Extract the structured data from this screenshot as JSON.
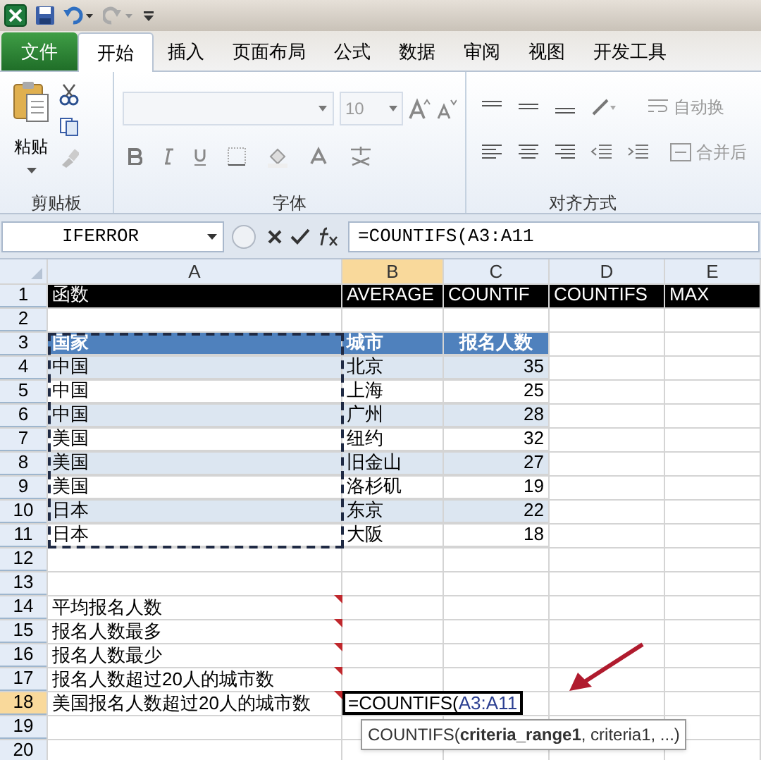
{
  "tabs": [
    {
      "label": "文件",
      "kind": "file",
      "selected": false
    },
    {
      "label": "开始",
      "kind": "tab",
      "selected": true
    },
    {
      "label": "插入",
      "kind": "tab",
      "selected": false
    },
    {
      "label": "页面布局",
      "kind": "tab",
      "selected": false
    },
    {
      "label": "公式",
      "kind": "tab",
      "selected": false
    },
    {
      "label": "数据",
      "kind": "tab",
      "selected": false
    },
    {
      "label": "审阅",
      "kind": "tab",
      "selected": false
    },
    {
      "label": "视图",
      "kind": "tab",
      "selected": false
    },
    {
      "label": "开发工具",
      "kind": "tab",
      "selected": false
    }
  ],
  "ribbon": {
    "clipboard": {
      "paste": "粘贴",
      "title": "剪贴板"
    },
    "font": {
      "size": "10",
      "title": "字体"
    },
    "alignment": {
      "wrap": "自动换",
      "merge": "合并后",
      "title": "对齐方式"
    }
  },
  "formula_bar": {
    "name_box": "IFERROR",
    "formula": "=COUNTIFS(A3:A11"
  },
  "columns": [
    {
      "letter": "A",
      "selected": false
    },
    {
      "letter": "B",
      "selected": true
    },
    {
      "letter": "C",
      "selected": false
    },
    {
      "letter": "D",
      "selected": false
    },
    {
      "letter": "E",
      "selected": false
    }
  ],
  "rows": [
    {
      "number": "1",
      "kind": "header",
      "selected": false,
      "cells": [
        "函数",
        "AVERAGE",
        "COUNTIF",
        "COUNTIFS",
        "MAX"
      ]
    },
    {
      "number": "2",
      "kind": "blank",
      "selected": false
    },
    {
      "number": "3",
      "kind": "table_head",
      "selected": false,
      "cells": [
        "国家",
        "城市",
        "报名人数"
      ]
    },
    {
      "number": "4",
      "kind": "table",
      "selected": false,
      "band": true,
      "cells": [
        "中国",
        "北京",
        "35"
      ]
    },
    {
      "number": "5",
      "kind": "table",
      "selected": false,
      "band": false,
      "cells": [
        "中国",
        "上海",
        "25"
      ]
    },
    {
      "number": "6",
      "kind": "table",
      "selected": false,
      "band": true,
      "cells": [
        "中国",
        "广州",
        "28"
      ]
    },
    {
      "number": "7",
      "kind": "table",
      "selected": false,
      "band": false,
      "cells": [
        "美国",
        "纽约",
        "32"
      ]
    },
    {
      "number": "8",
      "kind": "table",
      "selected": false,
      "band": true,
      "cells": [
        "美国",
        "旧金山",
        "27"
      ]
    },
    {
      "number": "9",
      "kind": "table",
      "selected": false,
      "band": false,
      "cells": [
        "美国",
        "洛杉矶",
        "19"
      ]
    },
    {
      "number": "10",
      "kind": "table",
      "selected": false,
      "band": true,
      "cells": [
        "日本",
        "东京",
        "22"
      ]
    },
    {
      "number": "11",
      "kind": "table",
      "selected": false,
      "band": false,
      "cells": [
        "日本",
        "大阪",
        "18"
      ]
    },
    {
      "number": "12",
      "kind": "blank",
      "selected": false
    },
    {
      "number": "13",
      "kind": "blank",
      "selected": false
    },
    {
      "number": "14",
      "kind": "label",
      "selected": false,
      "label": "平均报名人数",
      "comment": true
    },
    {
      "number": "15",
      "kind": "label",
      "selected": false,
      "label": "报名人数最多",
      "comment": true
    },
    {
      "number": "16",
      "kind": "label",
      "selected": false,
      "label": "报名人数最少",
      "comment": true
    },
    {
      "number": "17",
      "kind": "label",
      "selected": false,
      "label": "报名人数超过20人的城市数",
      "comment": true
    },
    {
      "number": "18",
      "kind": "label",
      "selected": true,
      "label": "美国报名人数超过20人的城市数",
      "comment": true,
      "edit": [
        {
          "kind": "plain",
          "text": "=COUNTIFS("
        },
        {
          "kind": "ref",
          "text": "A3:A11"
        }
      ]
    },
    {
      "number": "19",
      "kind": "blank",
      "selected": false
    },
    {
      "number": "20",
      "kind": "blank",
      "selected": false
    }
  ],
  "marquee": true,
  "tooltip": "COUNTIFS(**criteria_range1**, criteria1, ...)"
}
